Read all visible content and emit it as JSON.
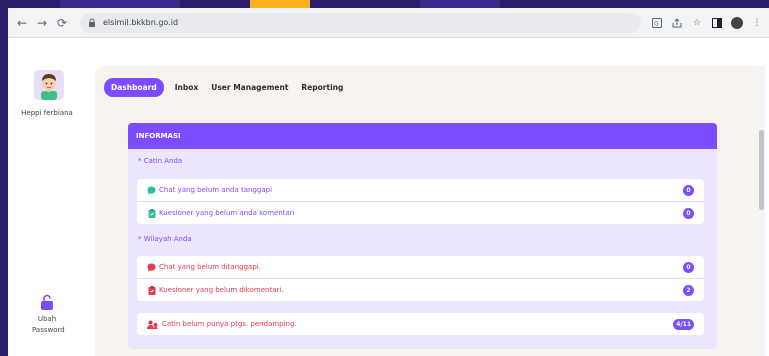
{
  "browser": {
    "url": "elsimil.bkkbn.go.id",
    "icons": [
      "back-arrow-icon",
      "forward-arrow-icon",
      "reload-icon",
      "lock-icon",
      "translate-icon",
      "share-icon",
      "star-icon",
      "sidepanel-icon",
      "profile-icon",
      "menu-icon"
    ]
  },
  "sidebar": {
    "user_name": "Heppi ferbiana",
    "change_password": "Ubah Password",
    "colors": {
      "lock": "#7c4dff"
    }
  },
  "tabs": [
    {
      "label": "Dashboard",
      "active": true
    },
    {
      "label": "Inbox",
      "active": false
    },
    {
      "label": "User Management",
      "active": false
    },
    {
      "label": "Reporting",
      "active": false
    }
  ],
  "card": {
    "title": "INFORMASI",
    "sections": [
      {
        "label": "* Catin Anda",
        "items": [
          {
            "icon": "chat-icon",
            "text": "Chat yang belum anda tanggapi",
            "count": "0",
            "color": "#7c4dff"
          },
          {
            "icon": "clipboard-icon",
            "text": "Kuesioner yang belum anda komentari",
            "count": "0",
            "color": "#7c4dff"
          }
        ]
      },
      {
        "label": "* Wilayah Anda",
        "items": [
          {
            "icon": "chat-icon",
            "text": "Chat yang belum ditanggapi.",
            "count": "0",
            "color": "#e53950"
          },
          {
            "icon": "clipboard-icon",
            "text": "Kuesioner yang belum dikomentari.",
            "count": "2",
            "color": "#e53950"
          }
        ]
      }
    ],
    "footer_item": {
      "icon": "users-icon",
      "text": "Catin belum punya ptgs. pendamping.",
      "count": "4/11",
      "color": "#e53950"
    }
  },
  "colors": {
    "accent": "#7c4dff",
    "card_bg": "#ece6fc",
    "main_bg": "#f7f3ee",
    "danger": "#e53950"
  }
}
